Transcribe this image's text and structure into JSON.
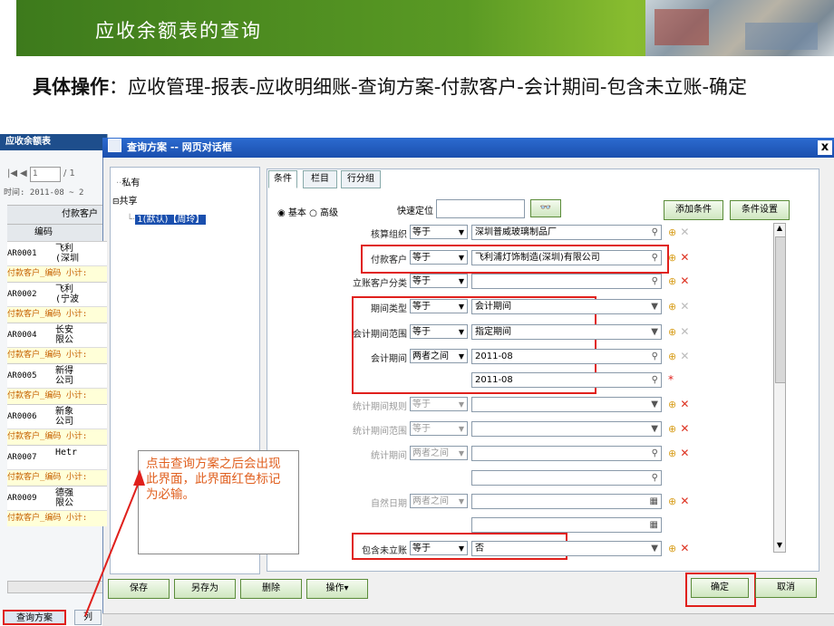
{
  "slide": {
    "title": "应收余额表的查询",
    "instruction_bold": "具体操作",
    "instruction_text": "：应收管理-报表-应收明细账-查询方案-付款客户-会计期间-包含未立账-确定"
  },
  "left_window": {
    "title": "应收余额表",
    "pager": "1",
    "pager_total": "/ 1",
    "time_label": "时间: 2011-08 ~ 2",
    "col_customer": "付款客户",
    "col_code": "编码",
    "rows": [
      {
        "code": "AR0001",
        "name": "飞利\n(深圳"
      },
      {
        "subtotal": "付款客户_编码 小计:"
      },
      {
        "code": "AR0002",
        "name": "飞利\n(宁波"
      },
      {
        "subtotal": "付款客户_编码 小计:"
      },
      {
        "code": "AR0004",
        "name": "长安\n限公"
      },
      {
        "subtotal": "付款客户_编码 小计:"
      },
      {
        "code": "AR0005",
        "name": "新得\n公司"
      },
      {
        "subtotal": "付款客户_编码 小计:"
      },
      {
        "code": "AR0006",
        "name": "新象\n公司"
      },
      {
        "subtotal": "付款客户_编码 小计:"
      },
      {
        "code": "AR0007",
        "name": "Hetr"
      },
      {
        "subtotal": "付款客户_编码 小计:"
      },
      {
        "code": "AR0009",
        "name": "德强\n限公"
      },
      {
        "subtotal": "付款客户_编码 小计:"
      }
    ],
    "bottom_tab_active": "查询方案",
    "bottom_tab_other": "列"
  },
  "dialog": {
    "title": "查询方案 -- 网页对话框",
    "close_label": "x",
    "tree": {
      "private": "私有",
      "shared": "共享",
      "default_scheme": "1(默认)【周玲】"
    },
    "tabs": [
      "条件",
      "栏目",
      "行分组"
    ],
    "mode_basic": "基本",
    "mode_advanced": "高级",
    "quick_locate_label": "快速定位",
    "search_button": "",
    "add_condition_button": "添加条件",
    "condition_settings_button": "条件设置",
    "fields": [
      {
        "label": "核算组织",
        "op": "等于",
        "value": "深圳普威玻璃制品厂",
        "icon": "search-icon",
        "action": "add-only",
        "disabled": false
      },
      {
        "label": "付款客户",
        "op": "等于",
        "value": "飞利浦灯饰制造(深圳)有限公司",
        "icon": "search-icon",
        "action": "add-del",
        "disabled": false
      },
      {
        "label": "立账客户分类",
        "op": "等于",
        "value": "",
        "icon": "search-icon",
        "action": "add-del",
        "disabled": false
      },
      {
        "label": "期间类型",
        "op": "等于",
        "value": "会计期间",
        "icon": "dropdown-icon",
        "action": "add-only",
        "disabled": false
      },
      {
        "label": "会计期间范围",
        "op": "等于",
        "value": "指定期间",
        "icon": "dropdown-icon",
        "action": "add-only",
        "disabled": false
      },
      {
        "label": "会计期间",
        "op": "两者之间",
        "value": "2011-08",
        "icon": "search-icon",
        "action": "add-only",
        "disabled": false
      },
      {
        "label": "",
        "op": "",
        "value": "2011-08",
        "icon": "search-icon",
        "action": "required",
        "disabled": false
      },
      {
        "label": "统计期间规则",
        "op": "等于",
        "value": "",
        "icon": "dropdown-icon",
        "action": "add-del",
        "disabled": true
      },
      {
        "label": "统计期间范围",
        "op": "等于",
        "value": "",
        "icon": "dropdown-icon",
        "action": "add-del",
        "disabled": true
      },
      {
        "label": "统计期间",
        "op": "两者之间",
        "value": "",
        "icon": "search-icon",
        "action": "add-del",
        "disabled": true
      },
      {
        "label": "",
        "op": "",
        "value": "",
        "icon": "search-icon",
        "action": "none",
        "disabled": true
      },
      {
        "label": "自然日期",
        "op": "两者之间",
        "value": "",
        "icon": "calendar-icon",
        "action": "add-del",
        "disabled": true
      },
      {
        "label": "",
        "op": "",
        "value": "",
        "icon": "calendar-icon",
        "action": "none",
        "disabled": true
      },
      {
        "label": "包含未立账",
        "op": "等于",
        "value": "否",
        "icon": "dropdown-icon",
        "action": "add-del",
        "disabled": false
      }
    ],
    "required_mark": "*",
    "buttons": {
      "save": "保存",
      "save_as": "另存为",
      "delete": "删除",
      "operate": "操作▾",
      "ok": "确定",
      "cancel": "取消"
    }
  },
  "callout": {
    "text": "点击查询方案之后会出现此界面，此界面红色标记为必输。"
  },
  "colors": {
    "highlight": "#e0201c",
    "title_bar": "#1a4fae",
    "note_text": "#e06020"
  }
}
